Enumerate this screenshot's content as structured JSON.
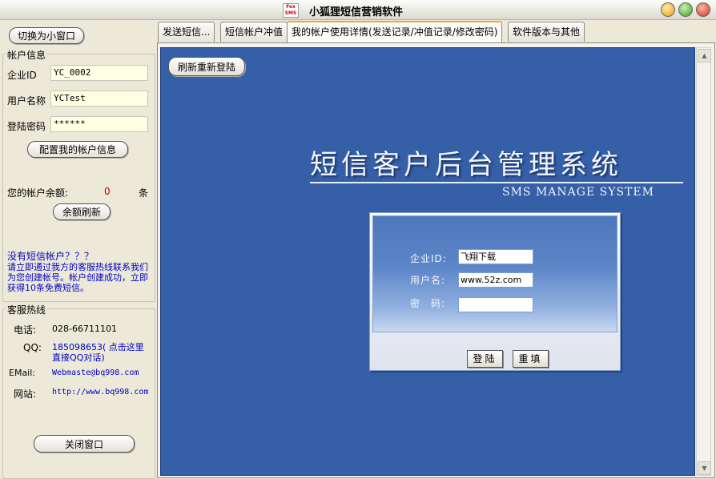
{
  "window": {
    "title": "小狐狸短信营销软件",
    "logo_text": "Fox SMS"
  },
  "left": {
    "mini_button": "切换为小窗口",
    "account_group": "帐户信息",
    "enterprise_id_label": "企业ID",
    "enterprise_id_value": "YC_0002",
    "username_label": "用户名称",
    "username_value": "YCTest",
    "password_label": "登陆密码",
    "password_value": "******",
    "config_button": "配置我的帐户信息",
    "balance_label": "您的帐户余额:",
    "balance_value": "0",
    "balance_unit": "条",
    "refresh_balance_button": "余额刷新",
    "no_account_title": "没有短信帐户？？？",
    "no_account_desc": "请立即通过我方的客服热线联系我们为您创建帐号。帐户创建成功，立即获得10条免费短信。",
    "hotline_group": "客服热线",
    "phone_label": "电话:",
    "phone_value": "028-66711101",
    "qq_label": "QQ:",
    "qq_value": "185098653( 点击这里直接QQ对话)",
    "email_label": "EMail:",
    "email_value": "Webmaste@bq998.com",
    "website_label": "网站:",
    "website_value": "http://www.bq998.com",
    "close_button": "关闭窗口"
  },
  "tabs": [
    {
      "label": "发送短信..."
    },
    {
      "label": "短信帐户冲值"
    },
    {
      "label": "我的帐户使用详情(发送记录/冲值记录/修改密码)"
    },
    {
      "label": "软件版本与其他"
    }
  ],
  "content": {
    "refresh_button": "刷新重新登陆",
    "system_title": "短信客户后台管理系统",
    "system_subtitle": "SMS MANAGE SYSTEM",
    "login": {
      "enterprise_label": "企业ID:",
      "enterprise_value": "飞翔下载",
      "username_label": "用户名:",
      "username_value": "www.52z.com",
      "password_label": "密　码:",
      "password_value": "",
      "login_button": "登陆",
      "reset_button": "重填"
    }
  },
  "colors": {
    "web_bg": "#355fa6",
    "field_bg": "#ffffe4",
    "link_blue": "#0000c8",
    "balance_red": "#d00000"
  }
}
